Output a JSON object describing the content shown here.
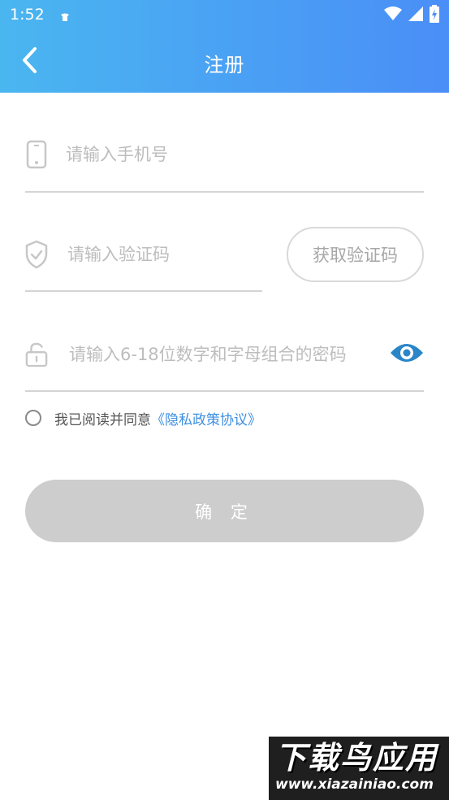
{
  "status_bar": {
    "time": "1:52"
  },
  "header": {
    "title": "注册",
    "back_icon": "chevron-left-icon"
  },
  "form": {
    "phone": {
      "placeholder": "请输入手机号",
      "value": "",
      "icon": "phone-icon"
    },
    "verify_code": {
      "placeholder": "请输入验证码",
      "value": "",
      "icon": "shield-check-icon",
      "get_code_label": "获取验证码"
    },
    "password": {
      "placeholder": "请输入6-18位数字和字母组合的密码",
      "value": "",
      "icon": "lock-icon",
      "toggle_icon": "eye-icon"
    },
    "agreement": {
      "prefix": "我已阅读并同意",
      "link_label": "《隐私政策协议》",
      "checked": false
    },
    "submit_label": "确 定"
  },
  "watermark": {
    "title": "下载鸟应用",
    "url": "www.xiazainiao.com"
  },
  "colors": {
    "header_gradient_start": "#4ab6f0",
    "header_gradient_end": "#4a8ef7",
    "link": "#3d8fe0",
    "eye_icon": "#2a86c8",
    "button_disabled": "#cdcdcd",
    "placeholder": "#bdbdbd"
  }
}
